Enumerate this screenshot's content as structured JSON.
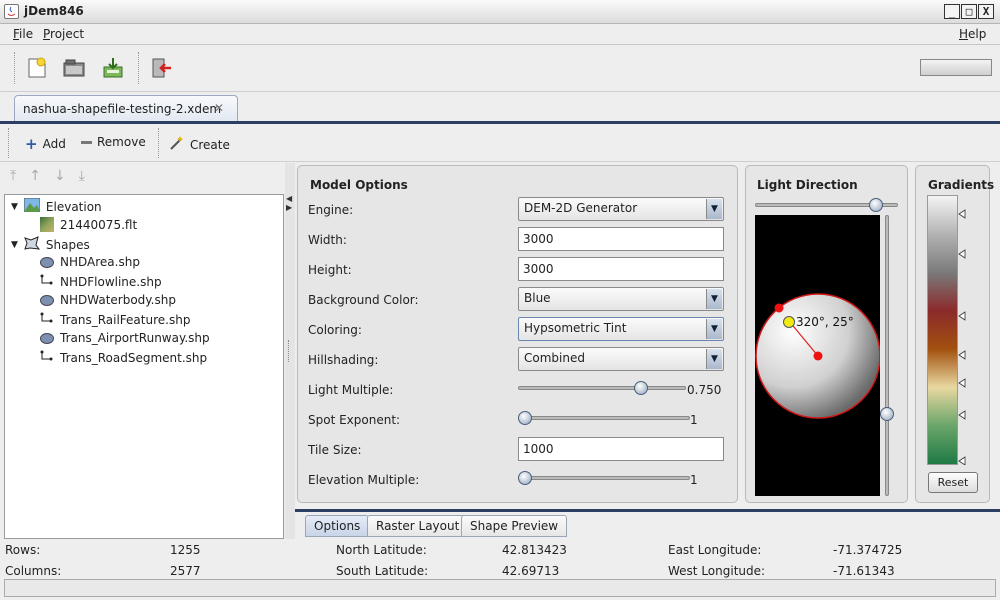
{
  "window": {
    "title": "jDem846",
    "minimize": "_",
    "maximize": "□",
    "close": "X"
  },
  "menu": {
    "file_first": "F",
    "file_rest": "ile",
    "project_first": "P",
    "project_rest": "roject",
    "help_first": "H",
    "help_rest": "elp"
  },
  "toolbar": {
    "icons": [
      "new-document-icon",
      "open-folder-icon",
      "save-export-icon",
      "exit-icon"
    ]
  },
  "document_tab": {
    "label": "nashua-shapefile-testing-2.xdem",
    "close": "✕"
  },
  "actions": {
    "add": "Add",
    "remove": "Remove",
    "create": "Create"
  },
  "tree": {
    "elevation": "Elevation",
    "elevation_file": "21440075.flt",
    "shapes": "Shapes",
    "shape_files": [
      "NHDArea.shp",
      "NHDFlowline.shp",
      "NHDWaterbody.shp",
      "Trans_RailFeature.shp",
      "Trans_AirportRunway.shp",
      "Trans_RoadSegment.shp"
    ]
  },
  "model_options": {
    "title": "Model Options",
    "engine_label": "Engine:",
    "engine_value": "DEM-2D Generator",
    "width_label": "Width:",
    "width_value": "3000",
    "height_label": "Height:",
    "height_value": "3000",
    "bgcolor_label": "Background Color:",
    "bgcolor_value": "Blue",
    "coloring_label": "Coloring:",
    "coloring_value": "Hypsometric Tint",
    "hillshading_label": "Hillshading:",
    "hillshading_value": "Combined",
    "light_multiple_label": "Light Multiple:",
    "light_multiple_value": "0.750",
    "light_multiple_fraction": 0.75,
    "spot_exponent_label": "Spot Exponent:",
    "spot_exponent_value": "1",
    "spot_exponent_fraction": 0.0,
    "tile_size_label": "Tile Size:",
    "tile_size_value": "1000",
    "elevation_multiple_label": "Elevation Multiple:",
    "elevation_multiple_value": "1",
    "elevation_multiple_fraction": 0.0
  },
  "light_direction": {
    "title": "Light Direction",
    "readout": "320°, 25°",
    "azimuth_deg": 320,
    "elevation_deg": 25
  },
  "gradients": {
    "title": "Gradients",
    "reset": "Reset",
    "colors": [
      "#f4f4f4",
      "#b3b3b3",
      "#7a7a7a",
      "#8b2a2a",
      "#a2510f",
      "#e8d8a0",
      "#6aa56a",
      "#1f7a45"
    ]
  },
  "bottom_tabs": [
    "Options",
    "Raster Layout",
    "Shape Preview"
  ],
  "status": {
    "rows_label": "Rows:",
    "rows_value": "1255",
    "columns_label": "Columns:",
    "columns_value": "2577",
    "north_label": "North Latitude:",
    "north_value": "42.813423",
    "south_label": "South Latitude:",
    "south_value": "42.69713",
    "east_label": "East Longitude:",
    "east_value": "-71.374725",
    "west_label": "West Longitude:",
    "west_value": "-71.61343"
  }
}
